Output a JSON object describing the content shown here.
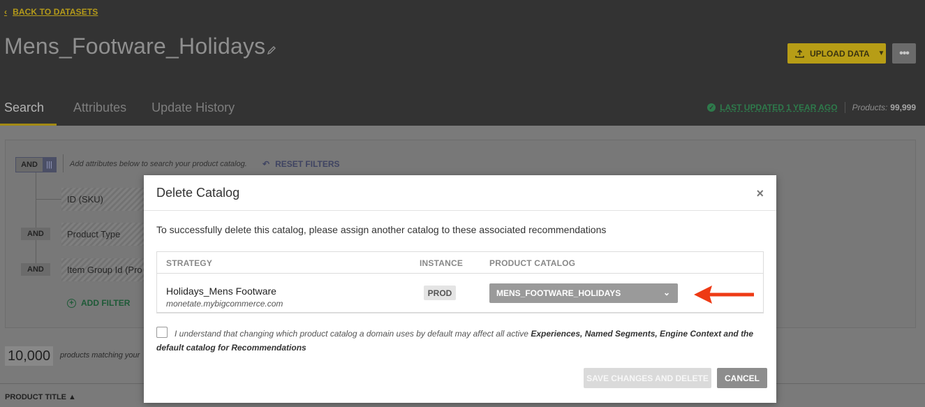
{
  "header": {
    "back_label": "BACK TO DATASETS",
    "title": "Mens_Footware_Holidays",
    "upload_label": "UPLOAD DATA",
    "more_label": "•••",
    "tabs": [
      {
        "label": "Search"
      },
      {
        "label": "Attributes"
      },
      {
        "label": "Update History"
      }
    ],
    "last_updated": "LAST UPDATED 1 YEAR AGO",
    "products_label": "Products:",
    "products_count": "99,999"
  },
  "filters": {
    "and_toggle": "AND",
    "hint": "Add attributes below to search your product catalog.",
    "reset_label": "RESET FILTERS",
    "attributes": [
      {
        "label": "ID (SKU)",
        "connector": ""
      },
      {
        "label": "Product Type",
        "connector": "AND"
      },
      {
        "label": "Item Group Id (Pro",
        "connector": "AND"
      }
    ],
    "add_filter_label": "ADD FILTER"
  },
  "results": {
    "count": "10,000",
    "count_text": "products matching your",
    "column_header": "PRODUCT TITLE ▲"
  },
  "modal": {
    "title": "Delete Catalog",
    "description": "To successfully delete this catalog, please assign another catalog to these associated recommendations",
    "columns": [
      "STRATEGY",
      "INSTANCE",
      "PRODUCT CATALOG"
    ],
    "row": {
      "strategy": "Holidays_Mens Footware",
      "domain": "monetate.mybigcommerce.com",
      "instance": "PROD",
      "catalog": "MENS_FOOTWARE_HOLIDAYS"
    },
    "ack_prefix": "I understand that changing which product catalog a domain uses by default may affect all active ",
    "ack_bold": "Experiences, Named Segments, Engine Context and the default catalog for Recommendations",
    "checkbox_checked": false,
    "save_label": "SAVE CHANGES AND DELETE",
    "cancel_label": "CANCEL"
  },
  "colors": {
    "accent": "#b79d16",
    "success": "#2e7a4b",
    "annotation_arrow": "#ee3a14"
  }
}
